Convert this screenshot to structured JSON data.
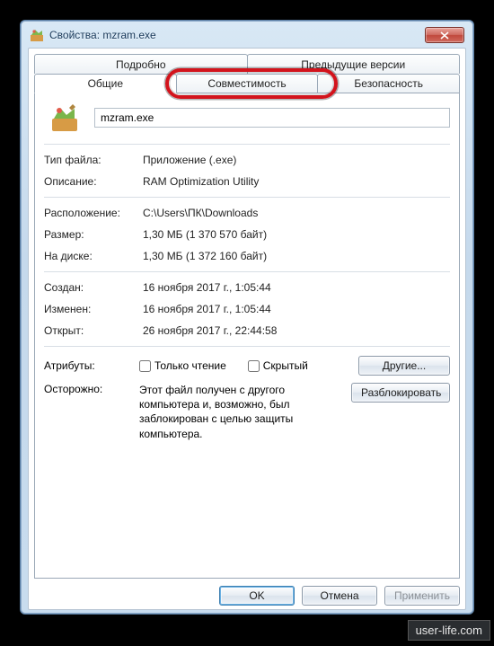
{
  "window": {
    "title": "Свойства: mzram.exe"
  },
  "tabs": {
    "top": [
      "Подробно",
      "Предыдущие версии"
    ],
    "bottom": [
      "Общие",
      "Совместимость",
      "Безопасность"
    ],
    "active": "Общие",
    "highlighted": "Совместимость"
  },
  "file": {
    "name_value": "mzram.exe"
  },
  "fields": {
    "type_label": "Тип файла:",
    "type_value": "Приложение (.exe)",
    "desc_label": "Описание:",
    "desc_value": "RAM Optimization Utility",
    "loc_label": "Расположение:",
    "loc_value": "C:\\Users\\ПК\\Downloads",
    "size_label": "Размер:",
    "size_value": "1,30 МБ (1 370 570 байт)",
    "disk_label": "На диске:",
    "disk_value": "1,30 МБ (1 372 160 байт)",
    "created_label": "Создан:",
    "created_value": "16 ноября 2017 г., 1:05:44",
    "modified_label": "Изменен:",
    "modified_value": "16 ноября 2017 г., 1:05:44",
    "opened_label": "Открыт:",
    "opened_value": "26 ноября 2017 г., 22:44:58"
  },
  "attributes": {
    "label": "Атрибуты:",
    "readonly": "Только чтение",
    "hidden": "Скрытый",
    "advanced_btn": "Другие..."
  },
  "caution": {
    "label": "Осторожно:",
    "text": "Этот файл получен с другого компьютера и, возможно, был заблокирован с целью защиты компьютера.",
    "unblock_btn": "Разблокировать"
  },
  "dialog_buttons": {
    "ok": "OK",
    "cancel": "Отмена",
    "apply": "Применить"
  },
  "watermark": "user-life.com"
}
